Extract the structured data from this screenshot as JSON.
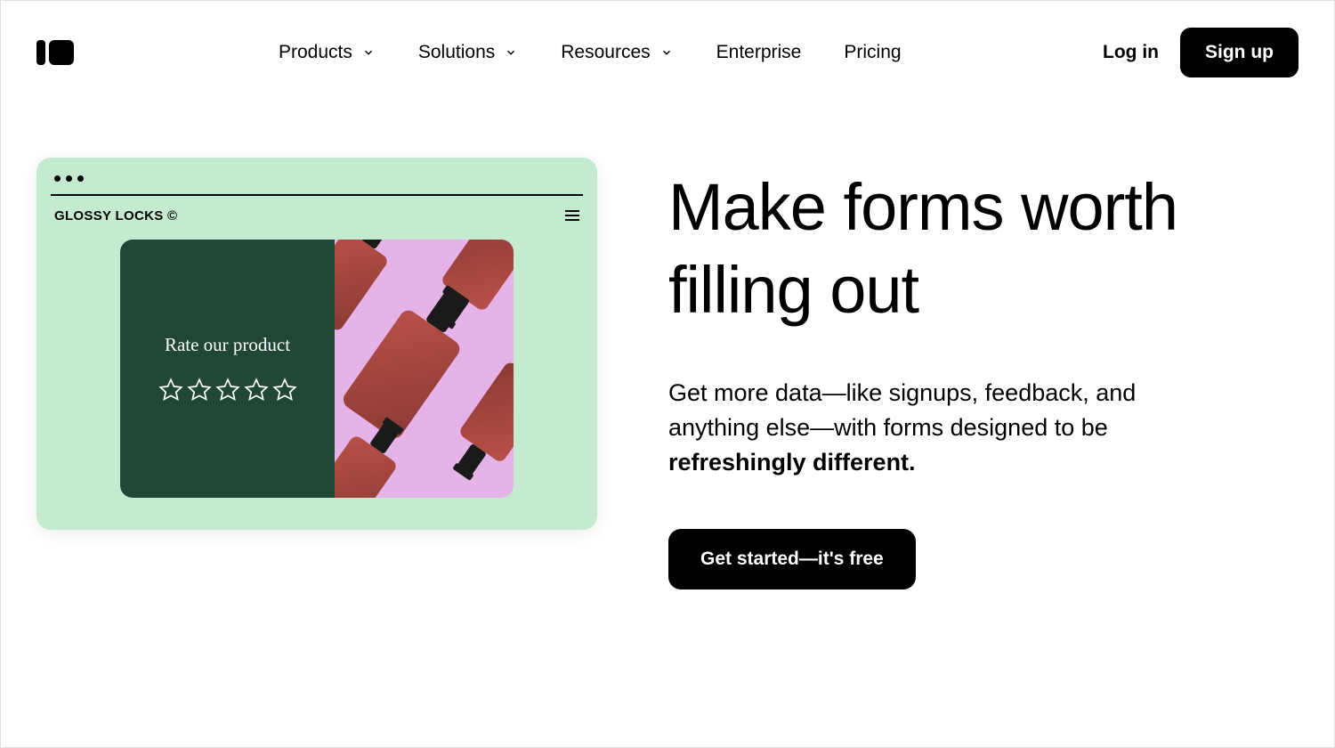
{
  "nav": {
    "items": [
      {
        "label": "Products",
        "hasDropdown": true
      },
      {
        "label": "Solutions",
        "hasDropdown": true
      },
      {
        "label": "Resources",
        "hasDropdown": true
      },
      {
        "label": "Enterprise",
        "hasDropdown": false
      },
      {
        "label": "Pricing",
        "hasDropdown": false
      }
    ]
  },
  "auth": {
    "login": "Log in",
    "signup": "Sign up"
  },
  "hero": {
    "title": "Make forms worth filling out",
    "subtitle_pre": "Get more data—like signups, feedback, and anything else—with forms designed to be ",
    "subtitle_bold": "refreshingly different.",
    "cta": "Get started—it's free"
  },
  "mockup": {
    "brand": "GLOSSY LOCKS ©",
    "rate_label": "Rate our product"
  }
}
